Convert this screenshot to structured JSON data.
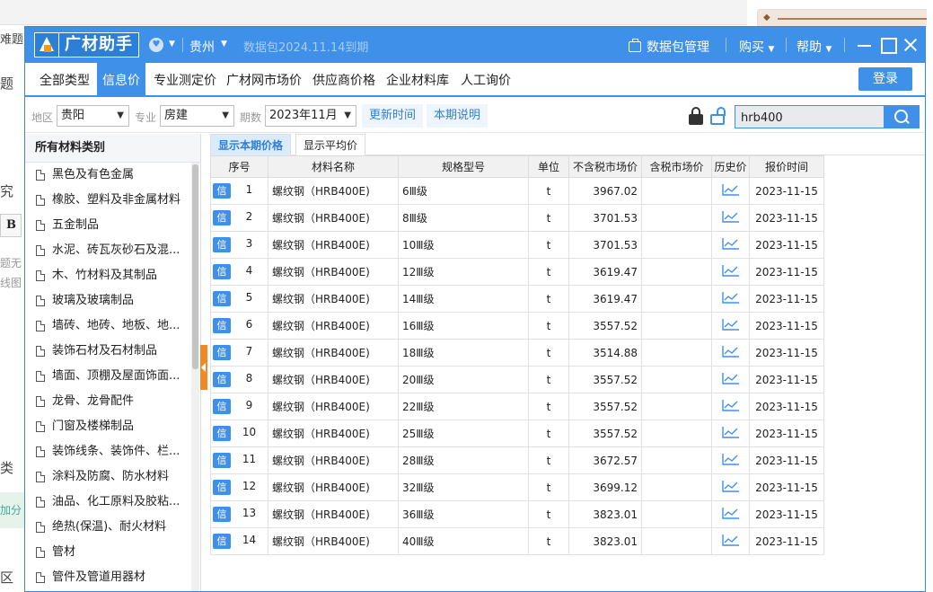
{
  "background": {
    "fragments": [
      "难题",
      "题",
      "究",
      "题无",
      "线图",
      "类",
      "加分",
      "区",
      "B"
    ]
  },
  "app": {
    "logo_text": "广材助手",
    "city": "贵州",
    "expire_notice": "数据包2024.11.14到期",
    "pkg_manage": "数据包管理",
    "buy": "购买",
    "help": "帮助"
  },
  "menu": {
    "items": [
      "全部类型",
      "信息价",
      "专业测定价",
      "广材网市场价",
      "供应商价格",
      "企业材料库",
      "人工询价"
    ],
    "active": "信息价",
    "login": "登录"
  },
  "filters": {
    "region_label": "地区",
    "region_value": "贵阳",
    "specialty_label": "专业",
    "specialty_value": "房建",
    "period_label": "期数",
    "period_value": "2023年11月",
    "update_time": "更新时间",
    "period_desc": "本期说明",
    "search_value": "hrb400"
  },
  "sidebar": {
    "header": "所有材料类别",
    "items": [
      "黑色及有色金属",
      "橡胶、塑料及非金属材料",
      "五金制品",
      "水泥、砖瓦灰砂石及混...",
      "木、竹材料及其制品",
      "玻璃及玻璃制品",
      "墙砖、地砖、地板、地...",
      "装饰石材及石材制品",
      "墙面、顶棚及屋面饰面...",
      "龙骨、龙骨配件",
      "门窗及楼梯制品",
      "装饰线条、装饰件、栏...",
      "涂料及防腐、防水材料",
      "油品、化工原料及胶粘...",
      "绝热(保温)、耐火材料",
      "管材",
      "管件及管道用器材"
    ]
  },
  "tabs": [
    "显示本期价格",
    "显示平均价"
  ],
  "table": {
    "headers": [
      "序号",
      "材料名称",
      "规格型号",
      "单位",
      "不含税市场价",
      "含税市场价",
      "历史价",
      "报价时间"
    ],
    "tag": "信",
    "rows": [
      {
        "no": "1",
        "name": "螺纹钢（HRB400E)",
        "spec": "6Ⅲ级",
        "unit": "t",
        "price": "3967.02",
        "tax_price": "",
        "date": "2023-11-15"
      },
      {
        "no": "2",
        "name": "螺纹钢（HRB400E)",
        "spec": "8Ⅲ级",
        "unit": "t",
        "price": "3701.53",
        "tax_price": "",
        "date": "2023-11-15"
      },
      {
        "no": "3",
        "name": "螺纹钢（HRB400E)",
        "spec": "10Ⅲ级",
        "unit": "t",
        "price": "3701.53",
        "tax_price": "",
        "date": "2023-11-15"
      },
      {
        "no": "4",
        "name": "螺纹钢（HRB400E)",
        "spec": "12Ⅲ级",
        "unit": "t",
        "price": "3619.47",
        "tax_price": "",
        "date": "2023-11-15"
      },
      {
        "no": "5",
        "name": "螺纹钢（HRB400E)",
        "spec": "14Ⅲ级",
        "unit": "t",
        "price": "3619.47",
        "tax_price": "",
        "date": "2023-11-15"
      },
      {
        "no": "6",
        "name": "螺纹钢（HRB400E)",
        "spec": "16Ⅲ级",
        "unit": "t",
        "price": "3557.52",
        "tax_price": "",
        "date": "2023-11-15"
      },
      {
        "no": "7",
        "name": "螺纹钢（HRB400E)",
        "spec": "18Ⅲ级",
        "unit": "t",
        "price": "3514.88",
        "tax_price": "",
        "date": "2023-11-15"
      },
      {
        "no": "8",
        "name": "螺纹钢（HRB400E)",
        "spec": "20Ⅲ级",
        "unit": "t",
        "price": "3557.52",
        "tax_price": "",
        "date": "2023-11-15"
      },
      {
        "no": "9",
        "name": "螺纹钢（HRB400E)",
        "spec": "22Ⅲ级",
        "unit": "t",
        "price": "3557.52",
        "tax_price": "",
        "date": "2023-11-15"
      },
      {
        "no": "10",
        "name": "螺纹钢（HRB400E)",
        "spec": "25Ⅲ级",
        "unit": "t",
        "price": "3557.52",
        "tax_price": "",
        "date": "2023-11-15"
      },
      {
        "no": "11",
        "name": "螺纹钢（HRB400E)",
        "spec": "28Ⅲ级",
        "unit": "t",
        "price": "3672.57",
        "tax_price": "",
        "date": "2023-11-15"
      },
      {
        "no": "12",
        "name": "螺纹钢（HRB400E)",
        "spec": "32Ⅲ级",
        "unit": "t",
        "price": "3699.12",
        "tax_price": "",
        "date": "2023-11-15"
      },
      {
        "no": "13",
        "name": "螺纹钢（HRB400E)",
        "spec": "36Ⅲ级",
        "unit": "t",
        "price": "3823.01",
        "tax_price": "",
        "date": "2023-11-15"
      },
      {
        "no": "14",
        "name": "螺纹钢（HRB400E)",
        "spec": "40Ⅲ级",
        "unit": "t",
        "price": "3823.01",
        "tax_price": "",
        "date": "2023-11-15"
      }
    ]
  },
  "colors": {
    "primary": "#3f90e9",
    "accent_orange": "#f08a26",
    "tab_active_bg": "#dcebfb"
  }
}
